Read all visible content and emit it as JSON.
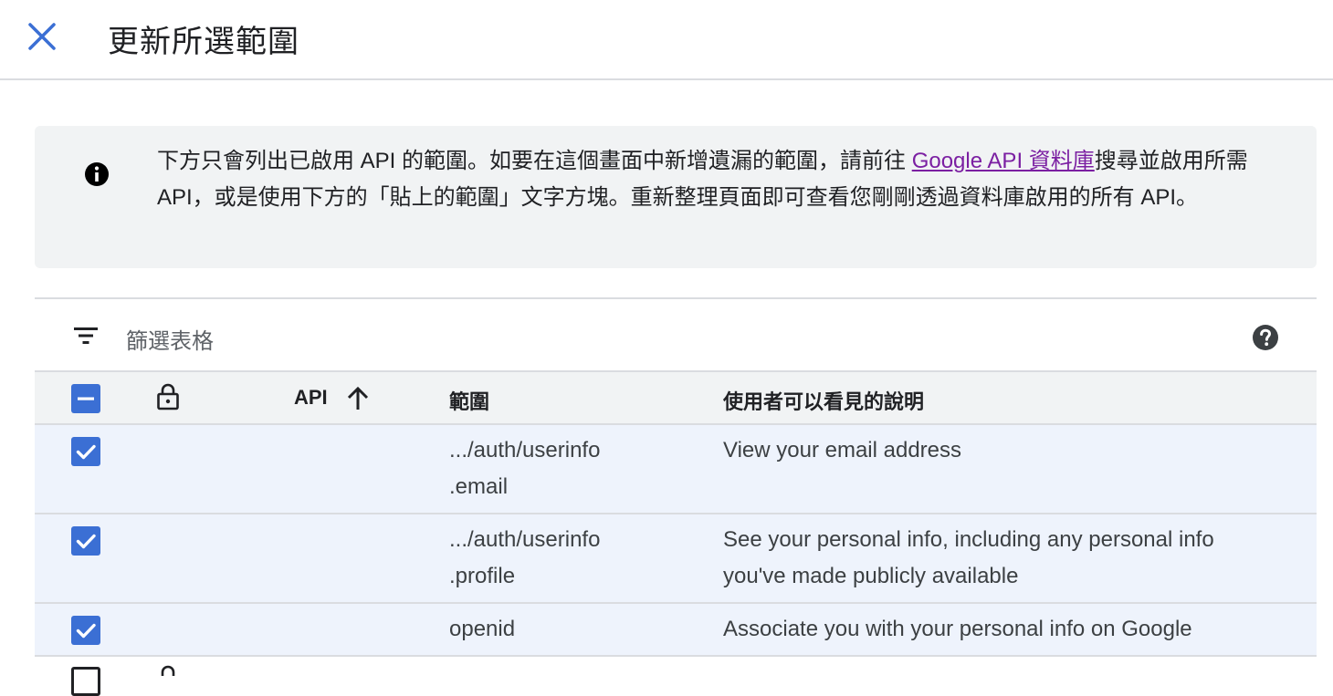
{
  "header": {
    "title": "更新所選範圍"
  },
  "info": {
    "text_before": "下方只會列出已啟用 API 的範圍。如要在這個畫面中新增遺漏的範圍，請前往 ",
    "link_text": "Google API 資料庫",
    "text_after": "搜尋並啟用所需 API，或是使用下方的「貼上的範圍」文字方塊。重新整理頁面即可查看您剛剛透過資料庫啟用的所有 API。"
  },
  "filter": {
    "label": "篩選表格"
  },
  "table": {
    "columns": {
      "api": "API",
      "scope": "範圍",
      "description": "使用者可以看見的說明"
    },
    "rows": [
      {
        "api": "",
        "scope_line1": ".../auth/userinfo",
        "scope_line2": ".email",
        "desc_line1": "View your email address",
        "desc_line2": "",
        "checked": true
      },
      {
        "api": "",
        "scope_line1": ".../auth/userinfo",
        "scope_line2": ".profile",
        "desc_line1": "See your personal info, including any personal info",
        "desc_line2": "you've made publicly available",
        "checked": true
      },
      {
        "api": "",
        "scope_line1": "openid",
        "scope_line2": "",
        "desc_line1": "Associate you with your personal info on Google",
        "desc_line2": "",
        "checked": true
      }
    ]
  },
  "colors": {
    "accent": "#3b6fd4",
    "link": "#7b1fa2",
    "row_selected": "#eef3fc",
    "header_bg": "#f1f3f4"
  }
}
